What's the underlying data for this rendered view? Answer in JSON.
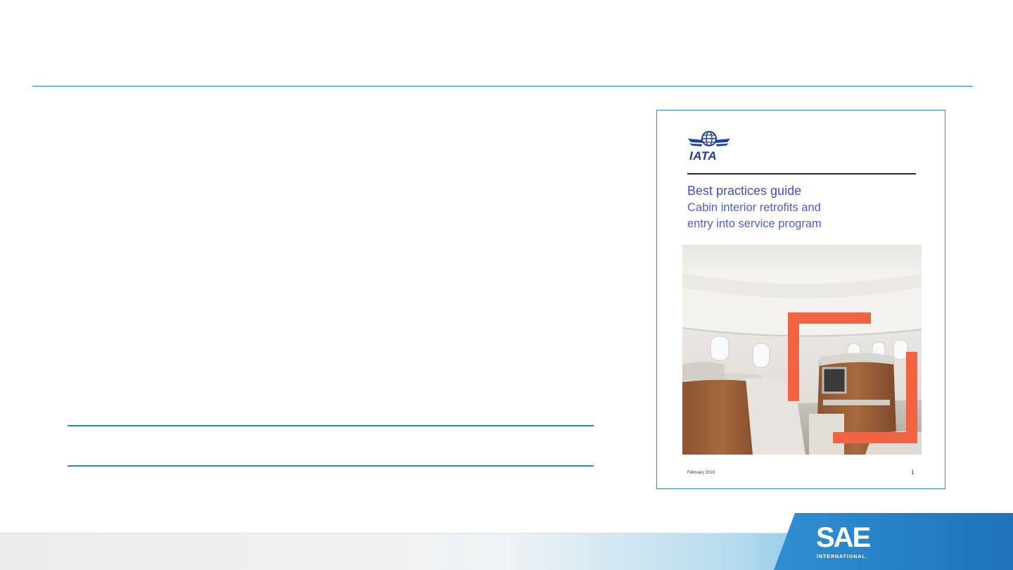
{
  "cover": {
    "logo_text": "IATA",
    "title": "Best practices guide",
    "subtitle_line1": "Cabin interior retrofits and",
    "subtitle_line2": "entry into service program",
    "date": "February 2019",
    "page_number": "1"
  },
  "footer": {
    "brand": "SAE",
    "brand_sub": "INTERNATIONAL."
  },
  "colors": {
    "rule_blue": "#1d8fd0",
    "title_blue": "#3c4fd6",
    "accent_orange": "#f06443",
    "iata_navy": "#1f3f9e"
  },
  "icons": [
    "iata-globe-wings-logo",
    "sae-logo"
  ]
}
